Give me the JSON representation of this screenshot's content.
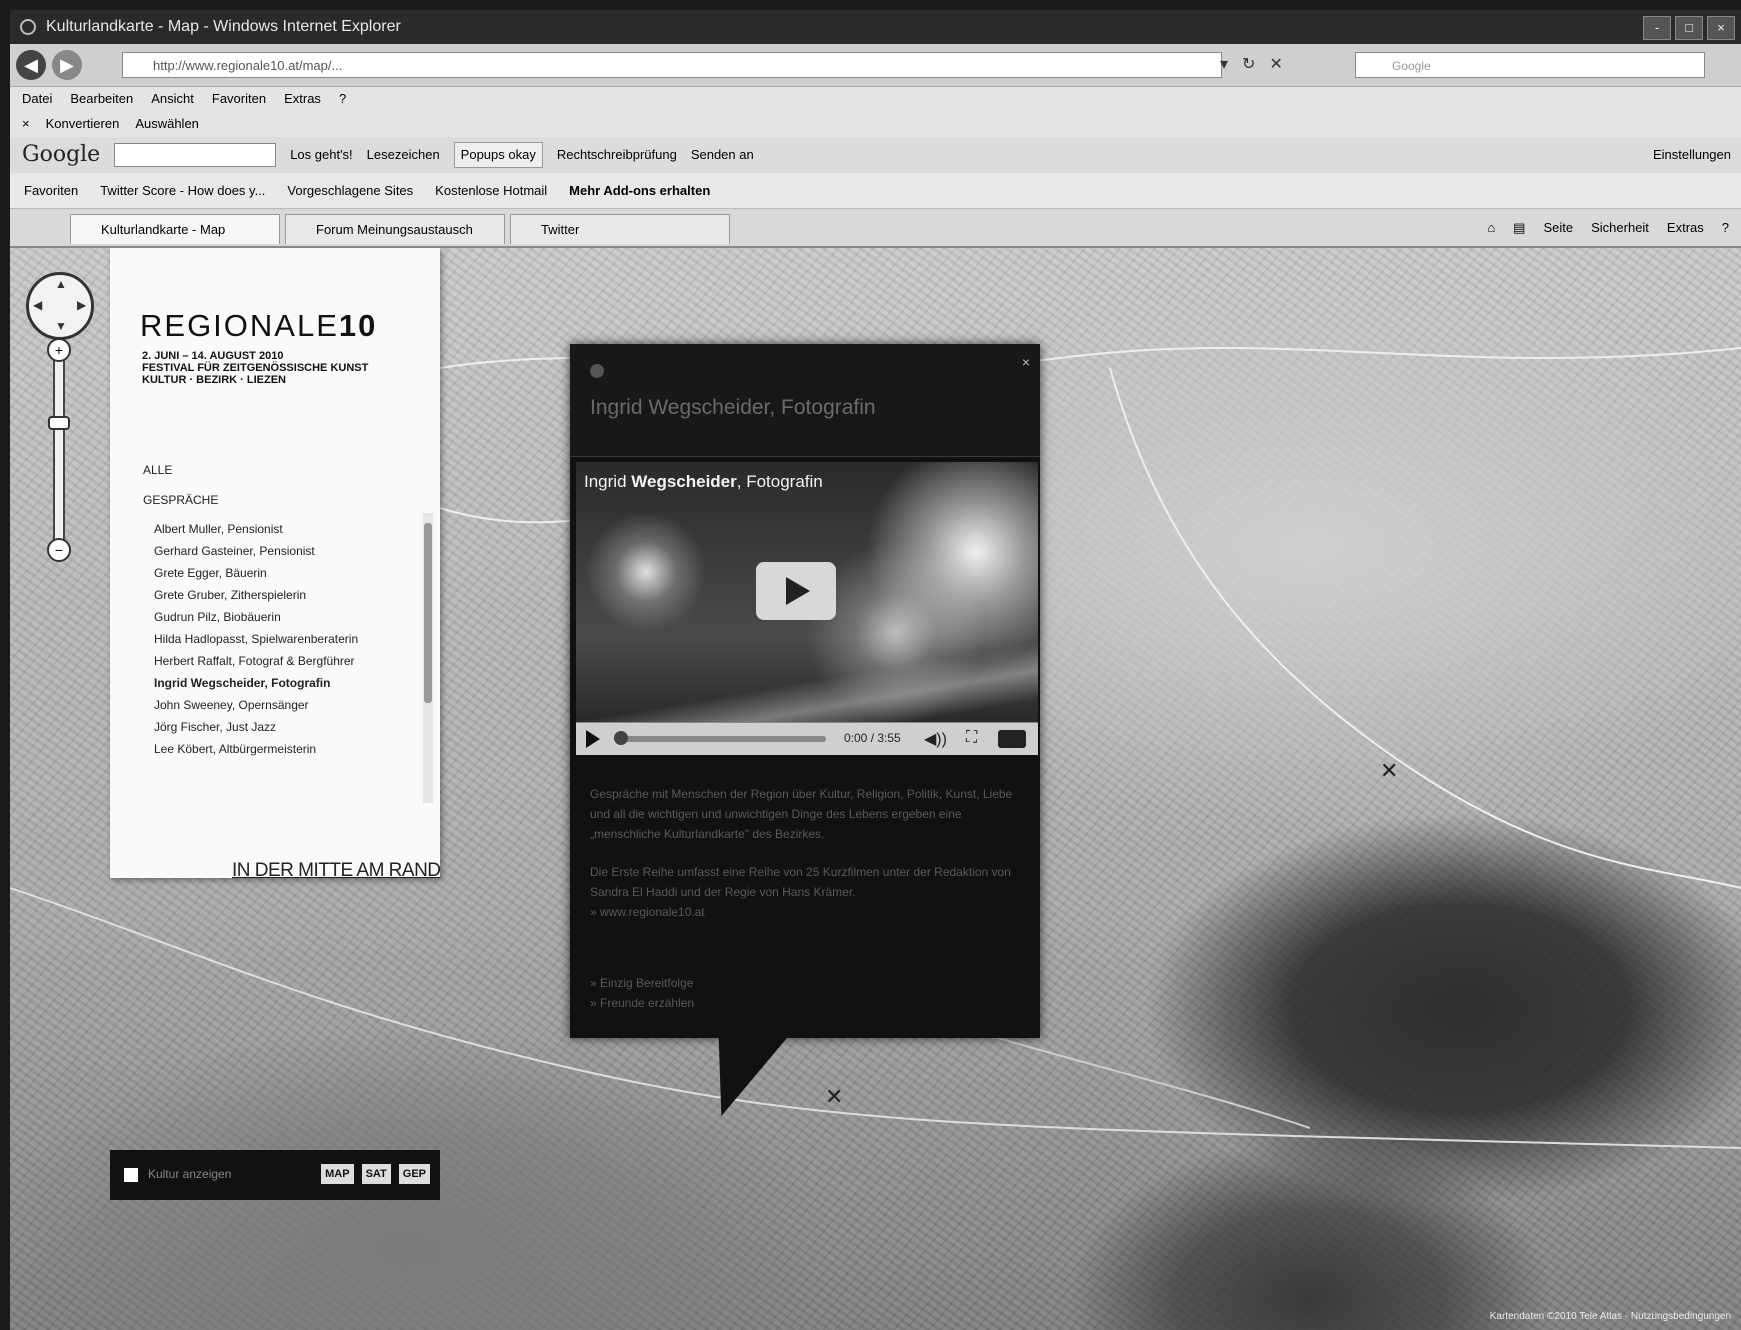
{
  "window": {
    "title": "Kulturlandkarte - Map - Windows Internet Explorer",
    "controls": [
      "-",
      "□",
      "×"
    ]
  },
  "addressbar": {
    "url": "http://www.regionale10.at/map/...",
    "search_placeholder": "Google"
  },
  "menubar": [
    "Datei",
    "Bearbeiten",
    "Ansicht",
    "Favoriten",
    "Extras",
    "?"
  ],
  "convbar": [
    "×",
    "Konvertieren",
    "Auswählen"
  ],
  "googlebar": {
    "logo": "Google",
    "items": [
      "Los geht's!",
      "Lesezeichen",
      "Popups okay",
      "Rechtschreibprüfung",
      "Senden an"
    ],
    "right": "Einstellungen"
  },
  "favbar": [
    "Favoriten",
    "Twitter Score - How does y...",
    "Vorgeschlagene Sites",
    "Kostenlose Hotmail",
    "Mehr Add-ons erhalten"
  ],
  "tabs": [
    {
      "label": "Kulturlandkarte - Map"
    },
    {
      "label": "Forum Meinungsaustausch"
    },
    {
      "label": "Twitter"
    }
  ],
  "tabtools": [
    "Seite",
    "Sicherheit",
    "Extras"
  ],
  "sidepanel": {
    "brand_light": "REGIONALE",
    "brand_bold": "10",
    "dates": "2. JUNI – 14. AUGUST 2010",
    "festival": "FESTIVAL FÜR ZEITGENÖSSISCHE KUNST",
    "district": "KULTUR · BEZIRK · LIEZEN",
    "filters": [
      "ALLE",
      "GESPRÄCHE"
    ],
    "people": [
      "Albert Muller, Pensionist",
      "Gerhard Gasteiner, Pensionist",
      "Grete Egger, Bäuerin",
      "Grete Gruber, Zitherspielerin",
      "Gudrun Pilz, Biobäuerin",
      "Hilda Hadlopasst, Spielwarenberaterin",
      "Herbert Raffalt, Fotograf & Bergführer",
      "Ingrid Wegscheider, Fotografin",
      "John Sweeney, Opernsänger",
      "Jörg Fischer, Just Jazz",
      "Lee Köbert, Altbürgermeisterin"
    ],
    "selected": "Ingrid Wegscheider, Fotografin",
    "tagline": "IN DER MITTE AM RAND"
  },
  "popup": {
    "title": "Ingrid Wegscheider, Fotografin",
    "video_caption_light": "Ingrid ",
    "video_caption_bold": "Wegscheider",
    "video_caption_rest": ", Fotografin",
    "time": "0:00 / 3:55",
    "text1": "Gespräche mit Menschen der Region über Kultur, Religion, Politik, Kunst, Liebe und all die wichtigen und unwichtigen Dinge des Lebens ergeben eine „menschliche Kulturlandkarte\" des Bezirkes.",
    "text2": "Die Erste Reihe umfasst eine Reihe von 25 Kurzfilmen unter der Redaktion von Sandra El Haddi und der Regie von Hans Krämer.",
    "link_url": "» www.regionale10.at",
    "link1": "» Einzig Bereitfolge",
    "link2": "» Freunde erzählen"
  },
  "bottombar": {
    "label": "Kultur anzeigen",
    "icons": [
      "MAP",
      "SAT",
      "GEP"
    ]
  },
  "copyright": "Kartendaten ©2010 Tele Atlas - Nutzungsbedingungen"
}
